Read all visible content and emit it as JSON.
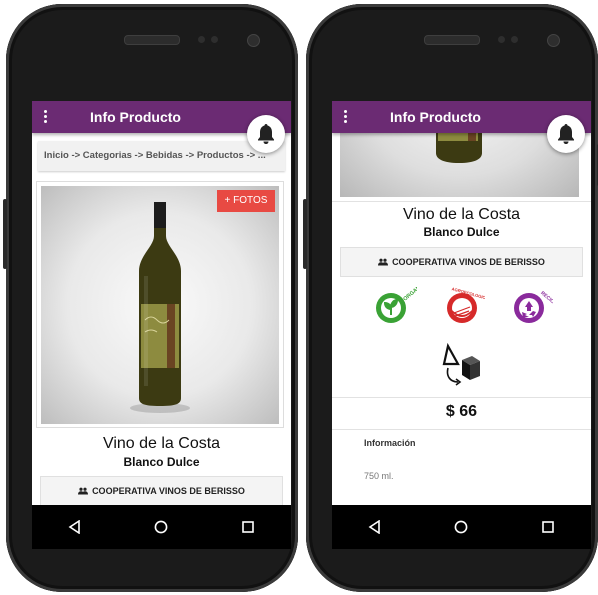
{
  "left_screen": {
    "appbar": {
      "title": "Info Producto",
      "menu_icon": "more-vert-icon",
      "bell_icon": "bell-icon"
    },
    "breadcrumb": "Inicio -> Categorias -> Bebidas -> Productos -> ...",
    "photo_button": "+ FOTOS",
    "product": {
      "name": "Vino de la Costa",
      "variety": "Blanco Dulce"
    },
    "cooperative": {
      "icon": "group-icon",
      "label": "COOPERATIVA VINOS DE BERISSO"
    }
  },
  "right_screen": {
    "appbar": {
      "title": "Info Producto",
      "menu_icon": "more-vert-icon",
      "bell_icon": "bell-icon"
    },
    "product": {
      "name": "Vino de la Costa",
      "variety": "Blanco Dulce"
    },
    "cooperative": {
      "icon": "group-icon",
      "label": "COOPERATIVA VINOS DE BERISSO"
    },
    "badges": [
      {
        "icon": "leaf-icon",
        "label": "ORGANICO",
        "color": "#3aa235"
      },
      {
        "icon": "agroecologico-icon",
        "label": "AGROECOLOGICO",
        "color": "#d62a2a"
      },
      {
        "icon": "recycle-icon",
        "label": "RECICLADO",
        "color": "#8a2a9c"
      }
    ],
    "packaging_icon": "box-rotate-icon",
    "price": "$ 66",
    "info": {
      "label": "Información",
      "value": "750 ml."
    }
  },
  "nav": [
    "back-icon",
    "home-icon",
    "recents-icon"
  ],
  "colors": {
    "appbar": "#6b2b73",
    "fotos_button": "#e84a43"
  }
}
